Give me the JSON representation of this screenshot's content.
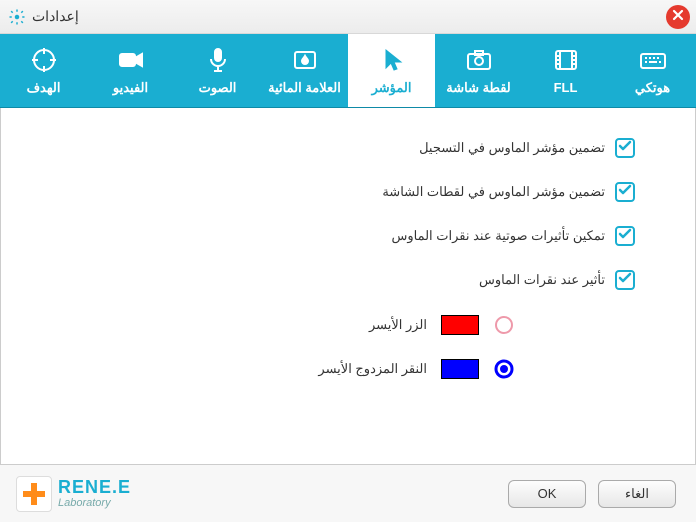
{
  "window": {
    "title": "إعدادات"
  },
  "tabs": {
    "target": {
      "label": "الهدف"
    },
    "video": {
      "label": "الفيديو"
    },
    "audio": {
      "label": "الصوت"
    },
    "watermark": {
      "label": "العلامة المائية"
    },
    "cursor": {
      "label": "المؤشر"
    },
    "screenshot": {
      "label": "لقطة شاشة"
    },
    "fll": {
      "label": "FLL"
    },
    "hotkey": {
      "label": "هوتكي"
    }
  },
  "options": {
    "include_cursor_recording": "تضمين مؤشر الماوس في التسجيل",
    "include_cursor_screenshot": "تضمين مؤشر الماوس في لقطات الشاشة",
    "enable_sound_on_click": "تمكين تأثيرات صوتية عند نقرات الماوس",
    "effect_on_click": "تأثير عند نقرات الماوس"
  },
  "colors": {
    "left_button": {
      "label": "الزر الأيسر",
      "value": "#ff0000",
      "selected": false
    },
    "double_click": {
      "label": "النقر المزدوج الأيسر",
      "value": "#0000ff",
      "selected": true
    }
  },
  "logo": {
    "brand": "RENE.E",
    "subtitle": "Laboratory"
  },
  "buttons": {
    "ok": "OK",
    "cancel": "الغاء"
  }
}
